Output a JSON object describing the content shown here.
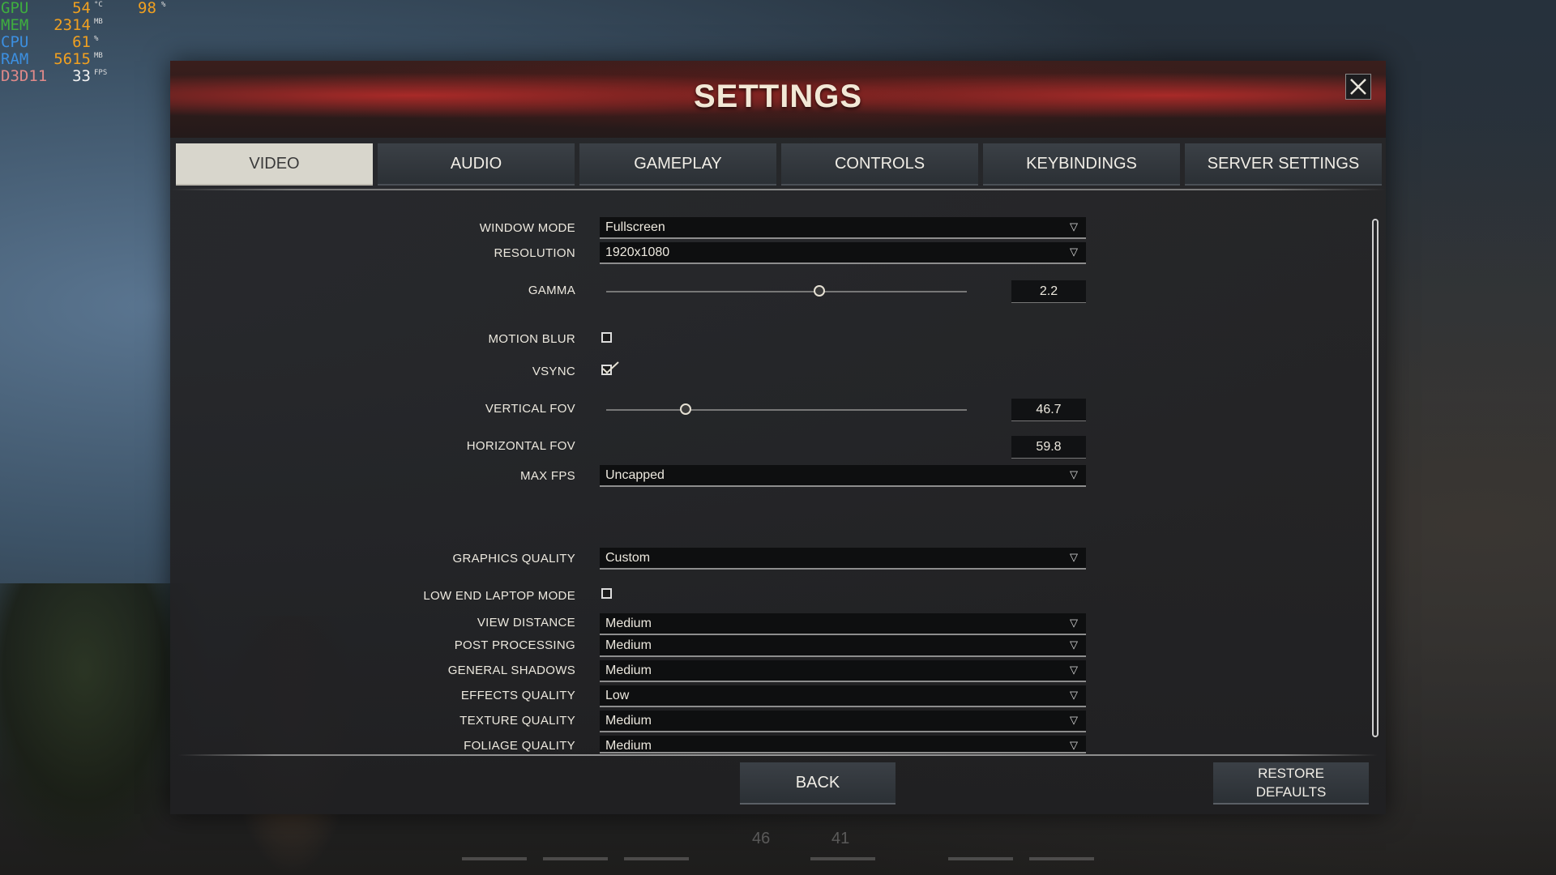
{
  "hud": {
    "rows": [
      {
        "label": "GPU",
        "value": "54",
        "unit": "°C",
        "value2": "98",
        "unit2": "%",
        "color": "#3fae3f"
      },
      {
        "label": "MEM",
        "value": "2314",
        "unit": "MB",
        "color": "#3fae3f"
      },
      {
        "label": "CPU",
        "value": "61",
        "unit": "%",
        "color": "#3c8fe0"
      },
      {
        "label": "RAM",
        "value": "5615",
        "unit": "MB",
        "color": "#3c8fe0"
      },
      {
        "label": "D3D11",
        "value": "33",
        "unit": "FPS",
        "color": "#e08a8a"
      }
    ]
  },
  "dialog": {
    "title": "SETTINGS",
    "close_icon": "close-icon",
    "tabs": [
      {
        "label": "VIDEO",
        "active": true
      },
      {
        "label": "AUDIO",
        "active": false
      },
      {
        "label": "GAMEPLAY",
        "active": false
      },
      {
        "label": "CONTROLS",
        "active": false
      },
      {
        "label": "KEYBINDINGS",
        "active": false
      },
      {
        "label": "SERVER SETTINGS",
        "active": false
      }
    ]
  },
  "video": {
    "window_mode": {
      "label": "WINDOW MODE",
      "value": "Fullscreen"
    },
    "resolution": {
      "label": "RESOLUTION",
      "value": "1920x1080"
    },
    "gamma": {
      "label": "GAMMA",
      "value": "2.2",
      "slider_fraction": 0.59
    },
    "motion_blur": {
      "label": "MOTION BLUR",
      "checked": false
    },
    "vsync": {
      "label": "VSYNC",
      "checked": true
    },
    "vertical_fov": {
      "label": "VERTICAL FOV",
      "value": "46.7",
      "slider_fraction": 0.22
    },
    "horizontal_fov": {
      "label": "HORIZONTAL FOV",
      "value": "59.8"
    },
    "max_fps": {
      "label": "MAX FPS",
      "value": "Uncapped"
    },
    "graphics_quality": {
      "label": "GRAPHICS QUALITY",
      "value": "Custom"
    },
    "low_end_laptop_mode": {
      "label": "LOW END LAPTOP MODE",
      "checked": false
    },
    "view_distance": {
      "label": "VIEW DISTANCE",
      "value": "Medium"
    },
    "post_processing": {
      "label": "POST PROCESSING",
      "value": "Medium"
    },
    "general_shadows": {
      "label": "GENERAL SHADOWS",
      "value": "Medium"
    },
    "effects_quality": {
      "label": "EFFECTS QUALITY",
      "value": "Low"
    },
    "texture_quality": {
      "label": "TEXTURE QUALITY",
      "value": "Medium"
    },
    "foliage_quality": {
      "label": "FOLIAGE QUALITY",
      "value": "Medium"
    }
  },
  "footer": {
    "back_label": "BACK",
    "restore_line1": "RESTORE",
    "restore_line2": "DEFAULTS"
  },
  "background_hud": {
    "left_number": "46",
    "right_number": "41"
  },
  "colors": {
    "accent_red": "#a82a28",
    "tab_active_bg": "#d8d6cc",
    "hud_value": "#f0a020"
  }
}
